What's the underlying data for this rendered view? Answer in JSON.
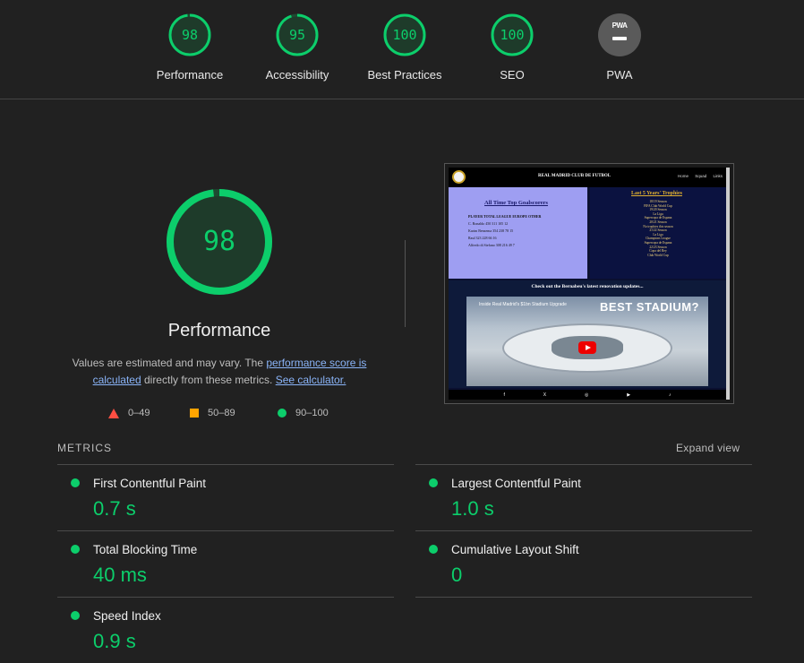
{
  "categories": [
    {
      "score": "98",
      "label": "Performance",
      "fraction": 0.98
    },
    {
      "score": "95",
      "label": "Accessibility",
      "fraction": 0.95
    },
    {
      "score": "100",
      "label": "Best Practices",
      "fraction": 1.0
    },
    {
      "score": "100",
      "label": "SEO",
      "fraction": 1.0
    }
  ],
  "pwa": {
    "badge_text": "PWA",
    "label": "PWA"
  },
  "main": {
    "score": "98",
    "score_fraction": 0.98,
    "title": "Performance",
    "desc_1": "Values are estimated and may vary. The ",
    "desc_link1": "performance score is calculated",
    "desc_2": " directly from these metrics. ",
    "desc_link2": "See calculator."
  },
  "legend": [
    {
      "shape": "triangle",
      "range": "0–49",
      "color": "#ff4e42"
    },
    {
      "shape": "square",
      "range": "50–89",
      "color": "#ffa400"
    },
    {
      "shape": "circle",
      "range": "90–100",
      "color": "#0cce6b"
    }
  ],
  "screenshot": {
    "brand": "REAL MADRID CLUB DE FUTBOL",
    "nav_links": "Home Squad Links",
    "goalscorers_title": "All Time Top Goalscorers",
    "table_header": "PLAYER   TOTAL LEAGUE EUROPE OTHER",
    "table_rows": [
      "C. Ronaldo    450   311   105   12",
      "Karim Benzema  354   238   78   15",
      "Raul          323   228   66   16",
      "Alfredo di Stefano  308  216  49  7"
    ],
    "trophies_title": "Last 5 Years' Trophies",
    "trophies": [
      "18/19 Season",
      "FIFA Club World Cup",
      "19/20 Season",
      "La Liga",
      "Supercopa de Espana",
      "20/21 Season",
      "No trophies this season",
      "21/22 Season",
      "La Liga",
      "Champions League",
      "Supercopa de Espana",
      "22/23 Season",
      "Copa del Rey",
      "Club World Cup"
    ],
    "band_text": "Check out the Bernabeu's latest renovation updates...",
    "video_title": "Inside Real Madrid's $1bn Stadium Upgrade",
    "video_banner": "BEST STADIUM?",
    "footer_icons": [
      "f",
      "X",
      "◎",
      "▶",
      "♪"
    ]
  },
  "metrics_header": "METRICS",
  "expand_label": "Expand view",
  "metrics": [
    {
      "name": "First Contentful Paint",
      "value": "0.7 s"
    },
    {
      "name": "Largest Contentful Paint",
      "value": "1.0 s"
    },
    {
      "name": "Total Blocking Time",
      "value": "40 ms"
    },
    {
      "name": "Cumulative Layout Shift",
      "value": "0"
    },
    {
      "name": "Speed Index",
      "value": "0.9 s"
    }
  ],
  "colors": {
    "pass": "#0cce6b",
    "average": "#ffa400",
    "fail": "#ff4e42",
    "link": "#8ab4f8",
    "background": "#212121"
  }
}
